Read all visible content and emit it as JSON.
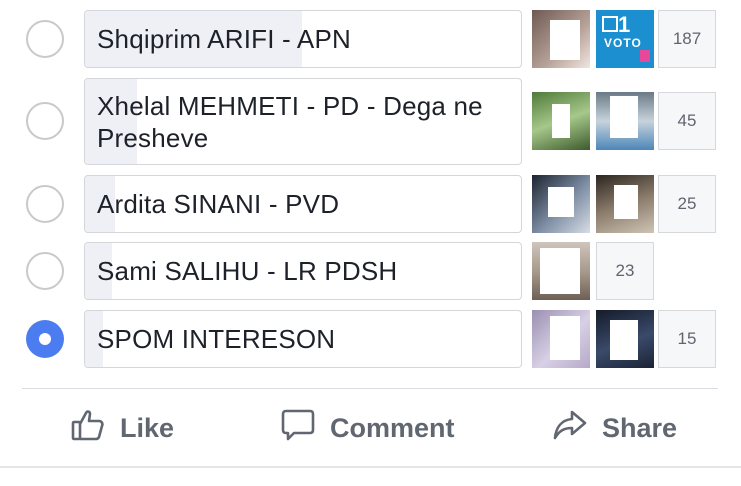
{
  "poll": {
    "options": [
      {
        "label": "Shqiprim ARIFI - APN",
        "count": "187",
        "selected": false,
        "fill": 0.49
      },
      {
        "label": "Xhelal MEHMETI - PD - Dega ne Presheve",
        "count": "45",
        "selected": false,
        "fill": 0.12
      },
      {
        "label": "Ardita SINANI - PVD",
        "count": "25",
        "selected": false,
        "fill": 0.07
      },
      {
        "label": "Sami SALIHU - LR PDSH",
        "count": "23",
        "selected": false,
        "fill": 0.06
      },
      {
        "label": "SPOM INTERESON",
        "count": "15",
        "selected": true,
        "fill": 0.04
      }
    ],
    "badge": {
      "number": "1",
      "word": "VOTO"
    }
  },
  "actions": {
    "like": "Like",
    "comment": "Comment",
    "share": "Share"
  },
  "colors": {
    "accent": "#4c7df0",
    "bar_fill": "#eef0f5",
    "action_text": "#606770"
  }
}
